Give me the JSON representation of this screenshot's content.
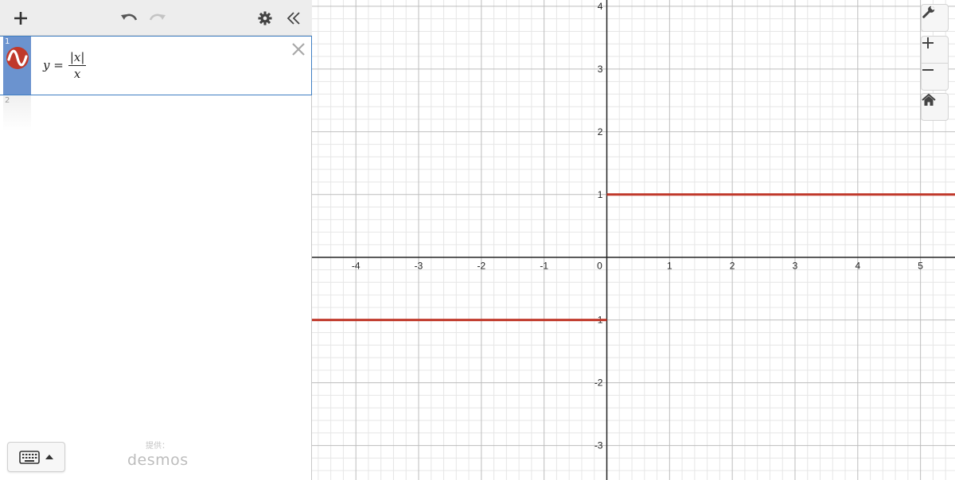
{
  "toolbar": {
    "add_icon": "plus-icon",
    "undo_icon": "undo-icon",
    "redo_icon": "redo-icon",
    "settings_icon": "gear-icon",
    "collapse_icon": "double-chevron-left-icon"
  },
  "expressions": [
    {
      "number": "1",
      "lhs": "y =",
      "numerator": "|x|",
      "denominator": "x",
      "color": "#c0392b",
      "selected": true
    },
    {
      "number": "2"
    }
  ],
  "footer": {
    "keyboard_icon": "keyboard-icon",
    "powered_by_label": "提供：",
    "logo_text": "desmos"
  },
  "graph_controls": {
    "settings_icon": "wrench-icon",
    "zoom_in_icon": "plus-icon",
    "zoom_out_icon": "minus-icon",
    "home_icon": "home-icon"
  },
  "chart_data": {
    "type": "line",
    "xlim": [
      -4.7,
      5.55
    ],
    "ylim": [
      -3.55,
      4.1
    ],
    "x_ticks": [
      "-4",
      "-3",
      "-2",
      "-1",
      "0",
      "1",
      "2",
      "3",
      "4",
      "5"
    ],
    "y_ticks": [
      "4",
      "3",
      "2",
      "1",
      "-1",
      "-2",
      "-3"
    ],
    "grid": true,
    "series": [
      {
        "color": "#c0392b",
        "segments": [
          {
            "x": [
              -4.7,
              0
            ],
            "y": [
              -1,
              -1
            ]
          },
          {
            "x": [
              0,
              5.55
            ],
            "y": [
              1,
              1
            ]
          }
        ]
      }
    ]
  }
}
